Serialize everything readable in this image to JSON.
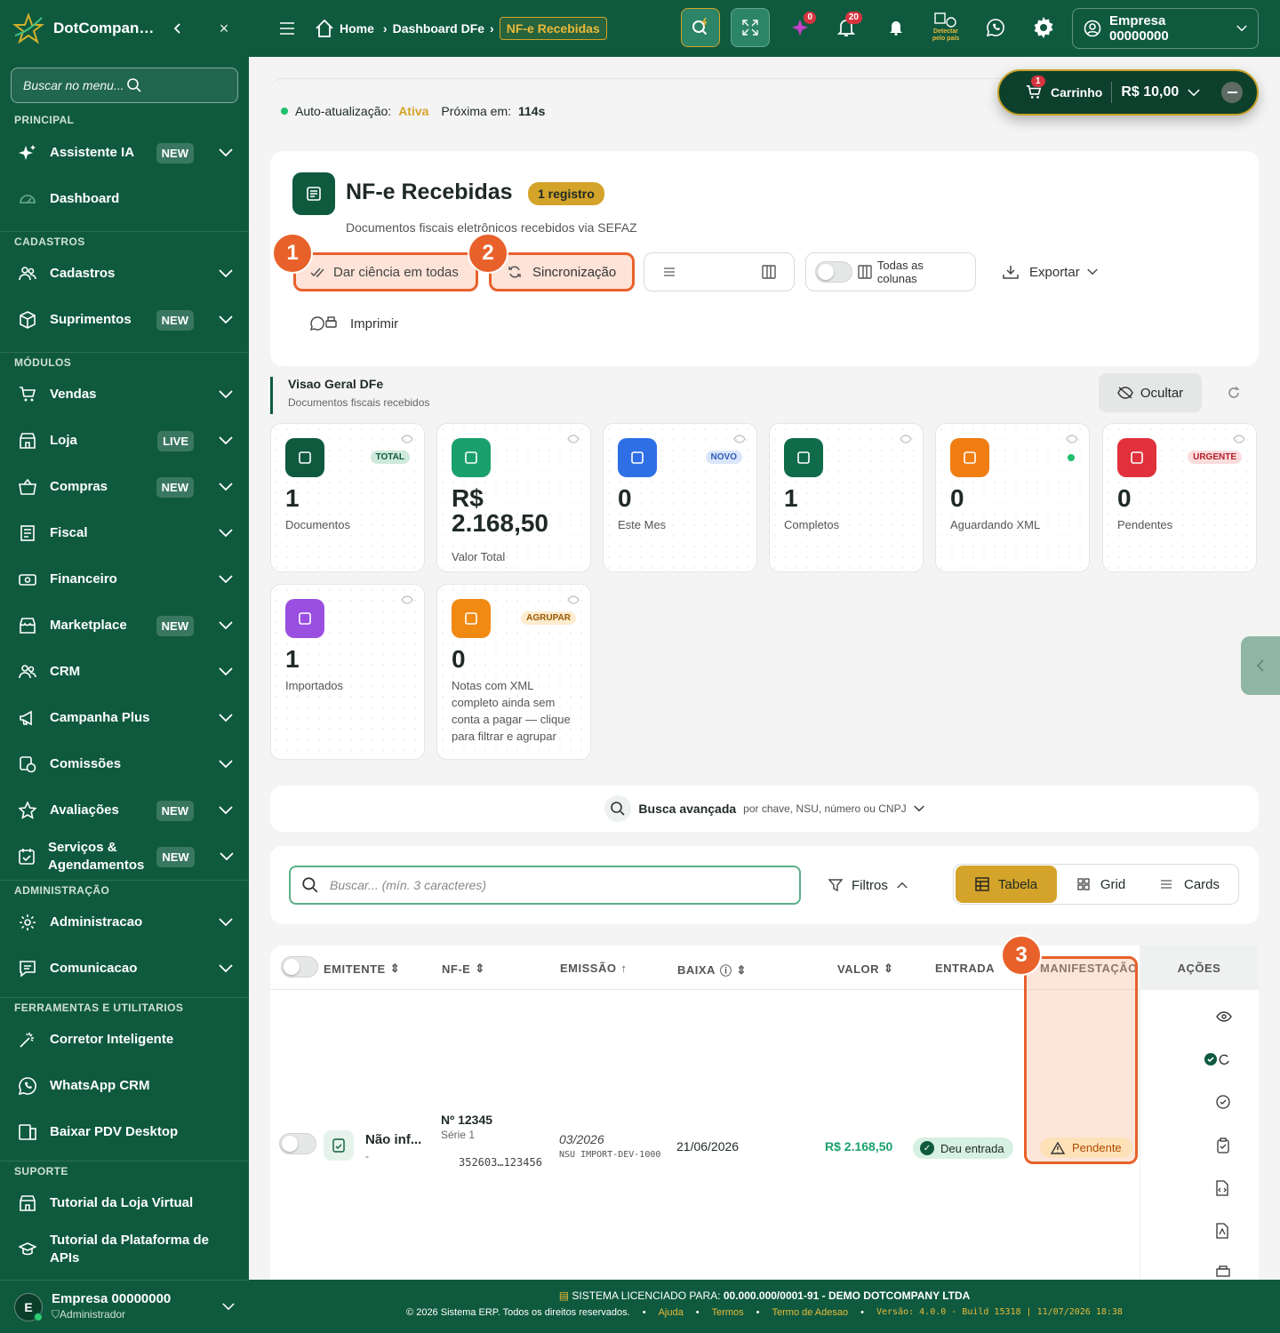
{
  "app": {
    "brand": "DotCompan…",
    "collapse_icon": "chevron-left-icon",
    "close_label": "×"
  },
  "sidebar": {
    "search_placeholder": "Buscar no menu...",
    "sections": {
      "principal": "PRINCIPAL",
      "cadastros": "CADASTROS",
      "modulos": "MÓDULOS",
      "admin": "ADMINISTRAÇÃO",
      "ferramentas": "FERRAMENTAS E UTILITARIOS",
      "suporte": "SUPORTE"
    },
    "items": {
      "assistente": {
        "label": "Assistente IA",
        "badge": "NEW"
      },
      "dashboard": {
        "label": "Dashboard"
      },
      "cadastros": {
        "label": "Cadastros"
      },
      "suprimentos": {
        "label": "Suprimentos",
        "badge": "NEW"
      },
      "vendas": {
        "label": "Vendas"
      },
      "loja": {
        "label": "Loja",
        "badge": "LIVE"
      },
      "compras": {
        "label": "Compras",
        "badge": "NEW"
      },
      "fiscal": {
        "label": "Fiscal"
      },
      "financeiro": {
        "label": "Financeiro"
      },
      "marketplace": {
        "label": "Marketplace",
        "badge": "NEW"
      },
      "crm": {
        "label": "CRM"
      },
      "campanha": {
        "label": "Campanha Plus"
      },
      "comissoes": {
        "label": "Comissões"
      },
      "avaliacoes": {
        "label": "Avaliações",
        "badge": "NEW"
      },
      "servicos": {
        "label": "Serviços & Agendamentos",
        "badge": "NEW"
      },
      "administracao": {
        "label": "Administracao"
      },
      "comunicacao": {
        "label": "Comunicacao"
      },
      "corretor": {
        "label": "Corretor Inteligente"
      },
      "whatsapp": {
        "label": "WhatsApp CRM"
      },
      "pdv": {
        "label": "Baixar PDV Desktop"
      },
      "tutorial_loja": {
        "label": "Tutorial da Loja Virtual"
      },
      "tutorial_api": {
        "label": "Tutorial da Plataforma de APIs"
      }
    },
    "user": {
      "initial": "E",
      "name": "Empresa 00000000",
      "role": "Administrador"
    }
  },
  "topbar": {
    "breadcrumb": [
      "Home",
      "Dashboard DFe",
      "NF-e Recebidas"
    ],
    "badges": {
      "sparkle": "0",
      "bell": "20"
    },
    "detect_label": "Detectar pelo país",
    "company": "Empresa 00000000"
  },
  "status": {
    "auto_label": "Auto-atualização:",
    "auto_value": "Ativa",
    "next_label": "Próxima em:",
    "next_value": "114s"
  },
  "cart": {
    "label": "Carrinho",
    "count": "1",
    "total": "R$ 10,00"
  },
  "page": {
    "title": "NF-e Recebidas",
    "count_badge": "1 registro",
    "subtitle": "Documentos fiscais eletrônicos recebidos via SEFAZ",
    "actions": {
      "ciencia": "Dar ciência em todas",
      "sync": "Sincronização",
      "all_columns": "Todas as colunas",
      "export": "Exportar",
      "print": "Imprimir"
    },
    "steps": [
      "1",
      "2",
      "3"
    ]
  },
  "overview": {
    "title": "Visao Geral DFe",
    "subtitle": "Documentos fiscais recebidos",
    "hide": "Ocultar",
    "stats": [
      {
        "value": "1",
        "label": "Documentos",
        "tag": "TOTAL",
        "color": "#0f5a3f",
        "tag_bg": "#cfe9dc",
        "tag_fg": "#0f5a3f",
        "icon": "document-icon"
      },
      {
        "value": "R$ 2.168,50",
        "label": "Valor Total",
        "tag": "",
        "color": "#1aa06d",
        "icon": "dollar-icon"
      },
      {
        "value": "0",
        "label": "Este Mes",
        "tag": "NOVO",
        "color": "#2e6fe6",
        "tag_bg": "#dbe6fb",
        "tag_fg": "#2e5bb8",
        "icon": "calendar-icon"
      },
      {
        "value": "1",
        "label": "Completos",
        "tag": "",
        "color": "#0f6b4a",
        "icon": "check-circle-icon"
      },
      {
        "value": "0",
        "label": "Aguardando XML",
        "tag": "",
        "color": "#f07d12",
        "icon": "hourglass-icon"
      },
      {
        "value": "0",
        "label": "Pendentes",
        "tag": "URGENTE",
        "color": "#e0313c",
        "tag_bg": "#fbdcdd",
        "tag_fg": "#b3222c",
        "icon": "alert-icon"
      },
      {
        "value": "1",
        "label": "Importados",
        "tag": "",
        "color": "#9b4fe0",
        "icon": "import-icon"
      },
      {
        "value": "0",
        "label": "Notas com XML completo ainda sem conta a pagar — clique para filtrar e agrupar",
        "tag": "AGRUPAR",
        "color": "#f08a12",
        "tag_bg": "#fdeccf",
        "tag_fg": "#9a5a00",
        "icon": "money-icon"
      }
    ]
  },
  "advanced_search": {
    "label": "Busca avançada",
    "hint": "por chave, NSU, número ou CNPJ"
  },
  "list_toolbar": {
    "search_placeholder": "Buscar... (mín. 3 caracteres)",
    "filters": "Filtros",
    "views": [
      "Tabela",
      "Grid",
      "Cards"
    ]
  },
  "table": {
    "headers": {
      "emitente": "EMITENTE",
      "nfe": "NF-E",
      "emissao": "EMISSÃO",
      "baixa": "BAIXA",
      "valor": "VALOR",
      "entrada": "ENTRADA",
      "manifestacao": "MANIFESTAÇÃO",
      "acoes": "AÇÕES"
    },
    "row": {
      "emitente": "Não inf...",
      "emitente_sub": "-",
      "nfe": "Nº 12345",
      "serie": "Série 1",
      "chave": "352603…123456",
      "emissao": "03/2026",
      "nsu": "NSU IMPORT-DEV-1000",
      "baixa": "21/06/2026",
      "valor": "R$ 2.168,50",
      "entrada": "Deu entrada",
      "manifestacao": "Pendente"
    }
  },
  "footer": {
    "licensed_label": "SISTEMA LICENCIADO PARA:",
    "licensed_value": "00.000.000/0001-91 - DEMO DOTCOMPANY LTDA",
    "copyright": "© 2026 Sistema ERP. Todos os direitos reservados.",
    "links": [
      "Ajuda",
      "Termos",
      "Termo de Adesao"
    ],
    "version": "Versão: 4.0.0 - Build 15318 | 11/07/2026 18:38"
  }
}
